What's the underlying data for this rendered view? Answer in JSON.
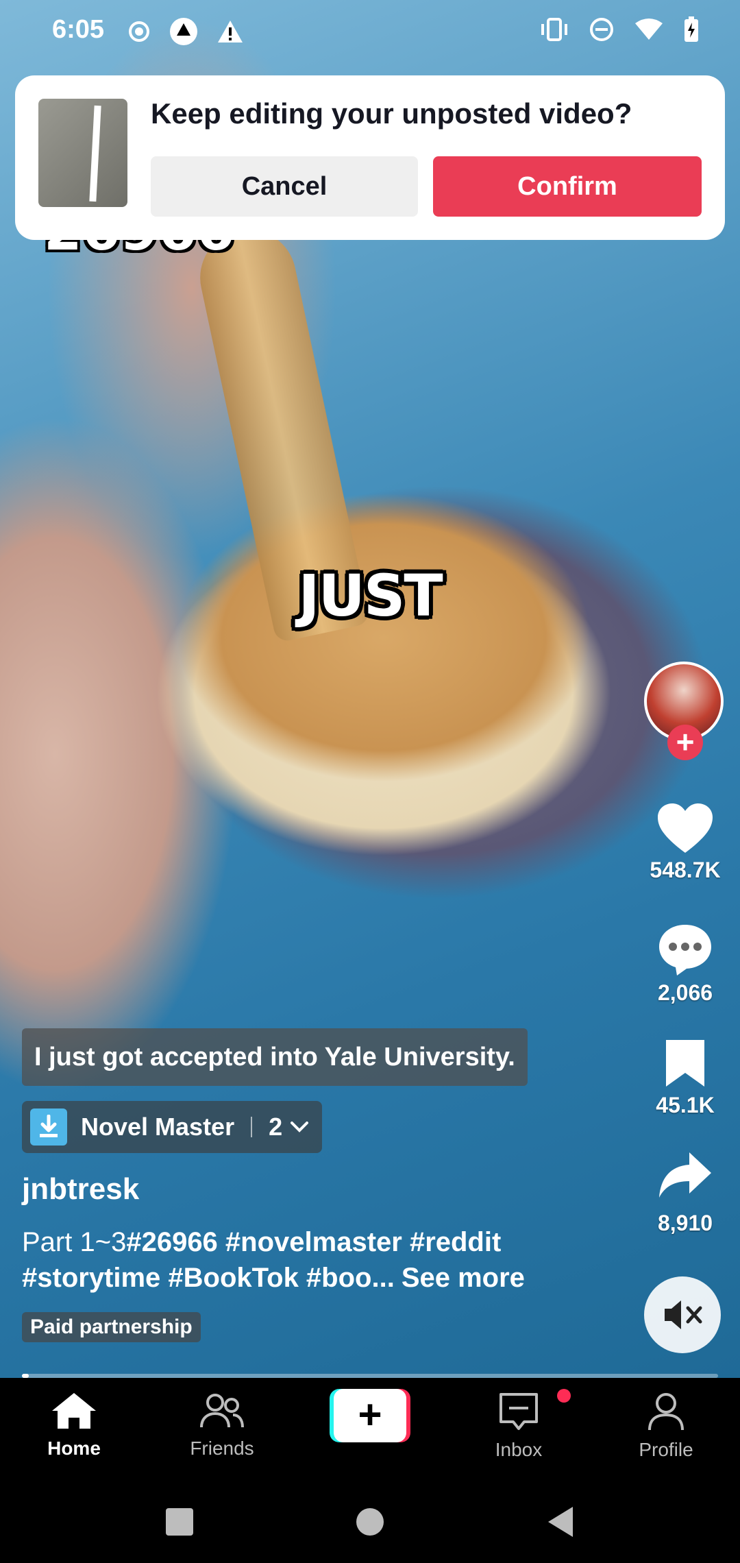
{
  "status_bar": {
    "time": "6:05",
    "left_icons": [
      "record-icon",
      "app-logo-icon",
      "warning-icon"
    ],
    "right_icons": [
      "vibrate-icon",
      "dnd-icon",
      "wifi-icon",
      "battery-icon"
    ]
  },
  "video": {
    "overlay_word": "JUST",
    "overlay_number": "26966"
  },
  "prompt": {
    "title": "Keep editing your unposted video?",
    "cancel_label": "Cancel",
    "confirm_label": "Confirm"
  },
  "rail": {
    "likes": "548.7K",
    "comments": "2,066",
    "saves": "45.1K",
    "shares": "8,910"
  },
  "caption": {
    "subtitle": "I just got accepted into Yale University.",
    "anchor_name": "Novel Master",
    "anchor_count": "2",
    "username": "jnbtresk",
    "description": "Part 1~3",
    "tags": "#26966 #novelmaster #reddit #storytime #BookTok #boo...",
    "see_more": "See more",
    "paid_label": "Paid partnership",
    "progress": 0.01
  },
  "nav": {
    "home": "Home",
    "friends": "Friends",
    "inbox": "Inbox",
    "profile": "Profile"
  },
  "colors": {
    "accent_red": "#ea3d55",
    "tiktok_cyan": "#25f4ee",
    "tiktok_pink": "#fe2c55"
  }
}
